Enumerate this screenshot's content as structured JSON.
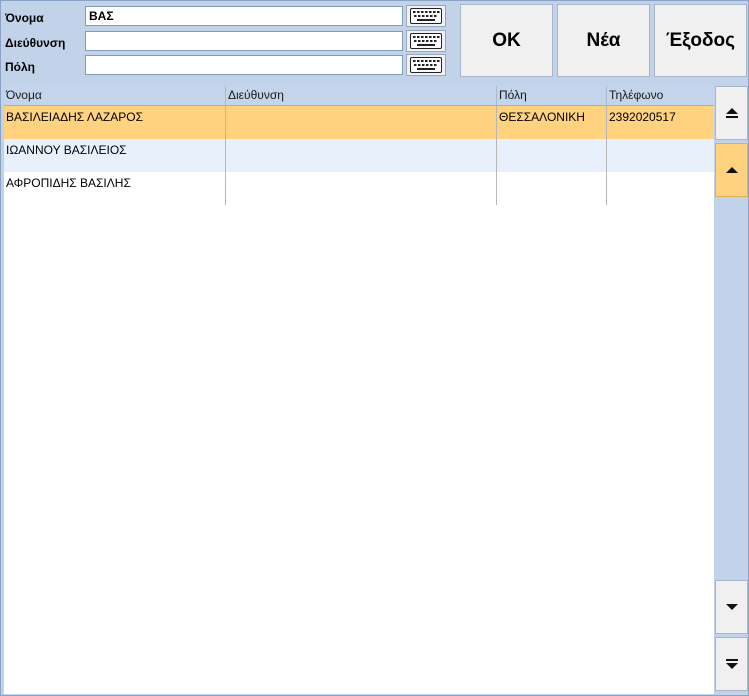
{
  "search": {
    "name_label": "Όνομα",
    "name_value": "ΒΑΣ",
    "address_label": "Διεύθυνση",
    "address_value": "",
    "city_label": "Πόλη",
    "city_value": ""
  },
  "buttons": {
    "ok": "ΟΚ",
    "new": "Νέα",
    "exit": "Έξοδος"
  },
  "table": {
    "columns": [
      "Όνομα",
      "Διεύθυνση",
      "Πόλη",
      "Τηλέφωνο"
    ],
    "rows": [
      [
        "ΒΑΣΙΛΕΙΑΔΗΣ ΛΑΖΑΡΟΣ",
        "",
        "ΘΕΣΣΑΛΟΝΙΚΗ",
        "2392020517"
      ],
      [
        "ΙΩΑΝΝΟΥ ΒΑΣΙΛΕΙΟΣ",
        "",
        "",
        ""
      ],
      [
        "ΑΦΡΟΠΙΔΗΣ ΒΑΣΙΛΗΣ",
        "",
        "",
        ""
      ]
    ]
  },
  "colors": {
    "selected_row": "#ffd27f",
    "alt_row": "#e8f1fb",
    "background": "#c2d3e9"
  },
  "icons": {
    "keyboard": "keyboard-icon",
    "scroll_top": "first-page-icon",
    "scroll_up": "arrow-up-icon",
    "scroll_down": "arrow-down-icon",
    "scroll_bottom": "last-page-icon"
  }
}
